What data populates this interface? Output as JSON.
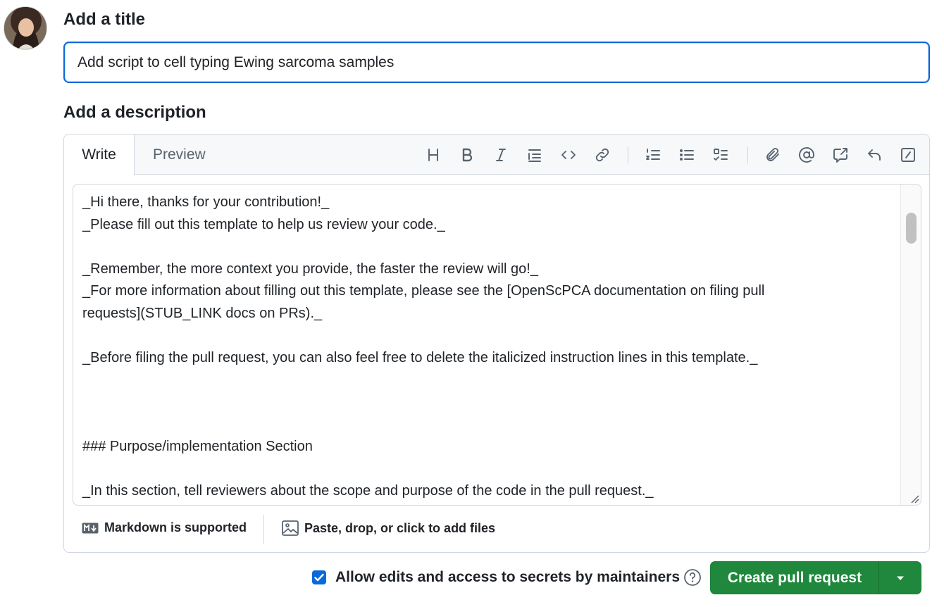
{
  "title_section": {
    "label": "Add a title",
    "value": "Add script to cell typing Ewing sarcoma samples"
  },
  "description_section": {
    "label": "Add a description",
    "tabs": [
      "Write",
      "Preview"
    ],
    "active_tab": "Write",
    "toolbar": [
      "heading-icon",
      "bold-icon",
      "italic-icon",
      "quote-icon",
      "code-icon",
      "link-icon",
      "ordered-list-icon",
      "unordered-list-icon",
      "task-list-icon",
      "attach-icon",
      "mention-icon",
      "cross-reference-icon",
      "undo-icon",
      "slash-commands-icon"
    ],
    "body_lines": [
      "_Hi there, thanks for your contribution!_",
      "_Please fill out this template to help us review your code._",
      "",
      "_Remember, the more context you provide, the faster the review will go!_",
      "_For more information about filling out this template, please see the [OpenScPCA documentation on filing pull",
      "requests](STUB_LINK docs on PRs)._",
      "",
      "_Before filing the pull request, you can also feel free to delete the italicized instruction lines in this template._",
      "",
      "",
      "",
      "### Purpose/implementation Section",
      "",
      "_In this section, tell reviewers about the scope and purpose of the code in the pull request._"
    ],
    "footer": {
      "markdown": "Markdown is supported",
      "files": "Paste, drop, or click to add files"
    }
  },
  "actions": {
    "allow_edits_label": "Allow edits and access to secrets by maintainers",
    "allow_edits_checked": true,
    "create_label": "Create pull request"
  },
  "colors": {
    "accent": "#0969da",
    "primary_button": "#1f883d"
  }
}
